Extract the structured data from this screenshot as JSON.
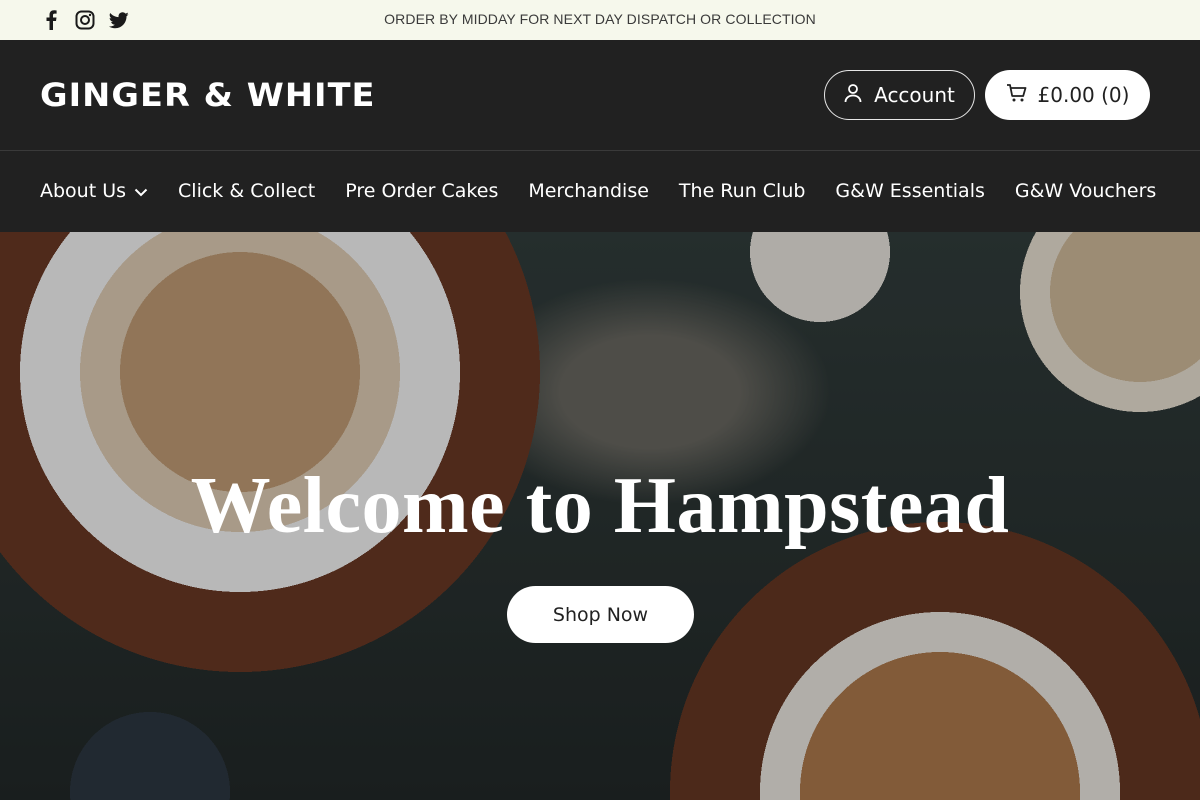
{
  "announcement": {
    "text": "ORDER BY MIDDAY FOR NEXT DAY DISPATCH OR COLLECTION",
    "social": [
      "facebook-icon",
      "instagram-icon",
      "twitter-icon"
    ]
  },
  "header": {
    "logo": "GINGER & WHITE",
    "account_label": "Account",
    "cart_label": "£0.00 (0)"
  },
  "nav": {
    "items": [
      {
        "label": "About Us",
        "has_dropdown": true
      },
      {
        "label": "Click & Collect"
      },
      {
        "label": "Pre Order Cakes"
      },
      {
        "label": "Merchandise"
      },
      {
        "label": "The Run Club"
      },
      {
        "label": "G&W Essentials"
      },
      {
        "label": "G&W Vouchers"
      }
    ]
  },
  "hero": {
    "title": "Welcome to Hampstead",
    "cta_label": "Shop Now"
  },
  "colors": {
    "announcement_bg": "#f6f8ec",
    "header_bg": "#212121",
    "text_light": "#ffffff"
  }
}
